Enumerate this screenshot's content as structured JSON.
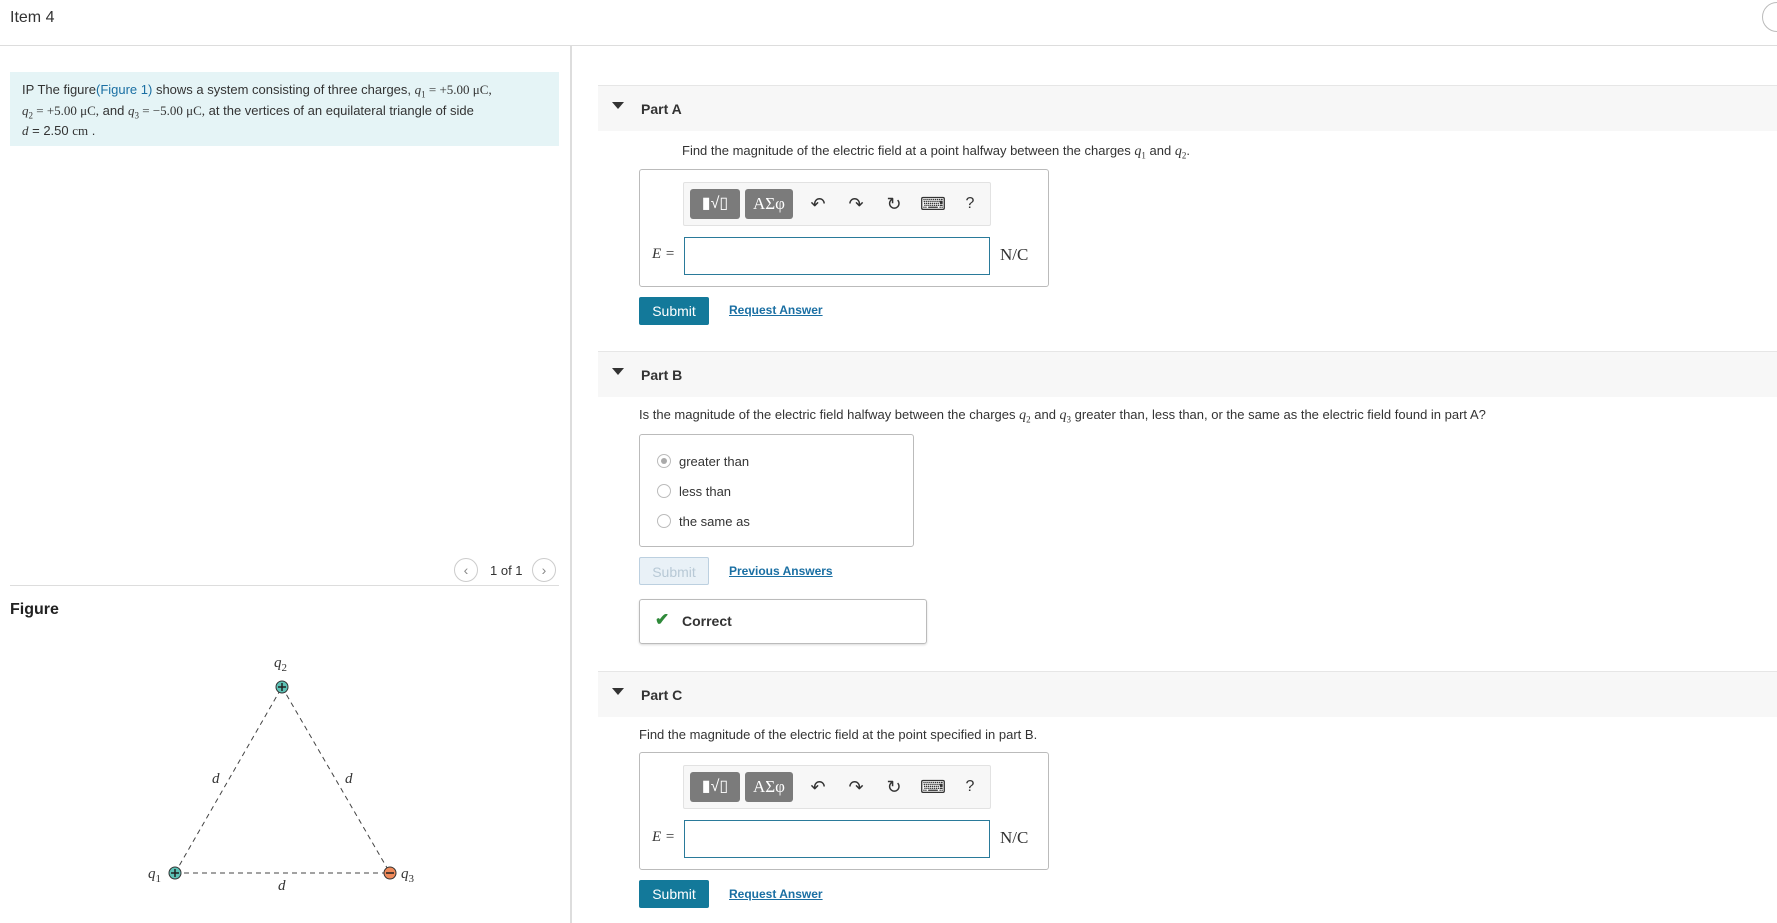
{
  "header": {
    "title": "Item 4"
  },
  "problem": {
    "prefix": "IP",
    "text1": " The figure",
    "figure_link": "(Figure 1)",
    "text2": " shows a system consisting of three charges, ",
    "q1": "q",
    "q1_sub": "1",
    "q1_val": " = +5.00 μC,",
    "q2": "q",
    "q2_sub": "2",
    "q2_val": " = +5.00 μC,",
    "and": " and ",
    "q3": "q",
    "q3_sub": "3",
    "q3_val": " = −5.00 μC,",
    "text3": " at the vertices of an equilateral triangle of side",
    "d_var": "d",
    "d_eq": " = 2.50 ",
    "d_unit": "cm",
    "d_end": " ."
  },
  "figure": {
    "heading": "Figure",
    "counter": "1 of 1",
    "prev_icon": "chevron-left-icon",
    "next_icon": "chevron-right-icon",
    "labels": {
      "q1": "q",
      "q1_sub": "1",
      "q2": "q",
      "q2_sub": "2",
      "q3": "q",
      "q3_sub": "3",
      "d": "d"
    }
  },
  "parts": {
    "a": {
      "label": "Part A",
      "question_pre": "Find the magnitude of the electric field at a point halfway between the charges ",
      "v1": "q",
      "v1_sub": "1",
      "mid": " and ",
      "v2": "q",
      "v2_sub": "2",
      "end": ".",
      "eq_label": "E =",
      "unit": "N/C",
      "submit": "Submit",
      "link": "Request Answer"
    },
    "b": {
      "label": "Part B",
      "question_pre": "Is the magnitude of the electric field halfway between the charges ",
      "v1": "q",
      "v1_sub": "2",
      "mid": " and ",
      "v2": "q",
      "v2_sub": "3",
      "end": " greater than, less than, or the same as the electric field found in part A?",
      "choices": [
        "greater than",
        "less than",
        "the same as"
      ],
      "selected": 0,
      "submit": "Submit",
      "link": "Previous Answers",
      "result": "Correct",
      "result_color": "#2f8a3a"
    },
    "c": {
      "label": "Part C",
      "question": "Find the magnitude of the electric field at the point specified in part B.",
      "eq_label": "E =",
      "unit": "N/C",
      "submit": "Submit",
      "link": "Request Answer"
    }
  },
  "toolbar": {
    "template_glyph": "▮√▯",
    "greek_glyph": "ΑΣφ",
    "undo": "↶",
    "redo": "↷",
    "reset": "↻",
    "keyboard": "⌨",
    "help": "?"
  },
  "colors": {
    "accent": "#13799a",
    "problem_bg": "#e5f4f6",
    "positive_charge": "#5dc2b6",
    "negative_charge": "#f08a5a"
  }
}
